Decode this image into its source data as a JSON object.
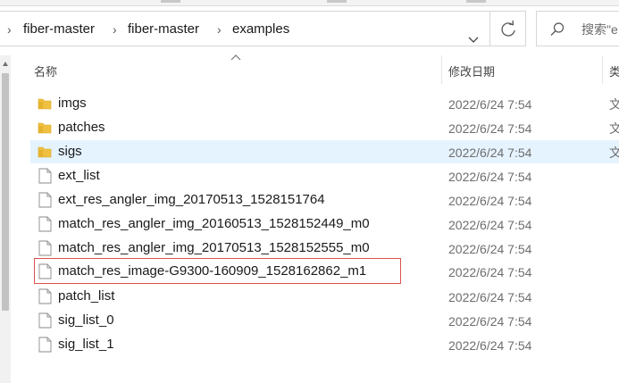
{
  "breadcrumb": [
    "fiber-master",
    "fiber-master",
    "examples"
  ],
  "search": {
    "placeholder": "搜索\"e"
  },
  "columns": {
    "name": "名称",
    "date_modified": "修改日期",
    "type": "类"
  },
  "files": [
    {
      "name": "imgs",
      "date": "2022/6/24 7:54",
      "type": "文",
      "kind": "folder-icon"
    },
    {
      "name": "patches",
      "date": "2022/6/24 7:54",
      "type": "文",
      "kind": "folder-icon"
    },
    {
      "name": "sigs",
      "date": "2022/6/24 7:54",
      "type": "文",
      "kind": "folder-icon",
      "selected": true
    },
    {
      "name": "ext_list",
      "date": "2022/6/24 7:54",
      "type": "",
      "kind": "file-icon"
    },
    {
      "name": "ext_res_angler_img_20170513_1528151764",
      "date": "2022/6/24 7:54",
      "type": "",
      "kind": "file-icon"
    },
    {
      "name": "match_res_angler_img_20160513_1528152449_m0",
      "date": "2022/6/24 7:54",
      "type": "",
      "kind": "file-icon"
    },
    {
      "name": "match_res_angler_img_20170513_1528152555_m0",
      "date": "2022/6/24 7:54",
      "type": "",
      "kind": "file-icon"
    },
    {
      "name": "match_res_image-G9300-160909_1528162862_m1",
      "date": "2022/6/24 7:54",
      "type": "",
      "kind": "file-icon",
      "highlighted": true
    },
    {
      "name": "patch_list",
      "date": "2022/6/24 7:54",
      "type": "",
      "kind": "file-icon"
    },
    {
      "name": "sig_list_0",
      "date": "2022/6/24 7:54",
      "type": "",
      "kind": "file-icon"
    },
    {
      "name": "sig_list_1",
      "date": "2022/6/24 7:54",
      "type": "",
      "kind": "file-icon"
    }
  ],
  "colors": {
    "folder": "#f0c040",
    "selected_row": "#e5f3ff",
    "highlight_border": "#d9534f",
    "date_text": "#6d6d6d"
  }
}
